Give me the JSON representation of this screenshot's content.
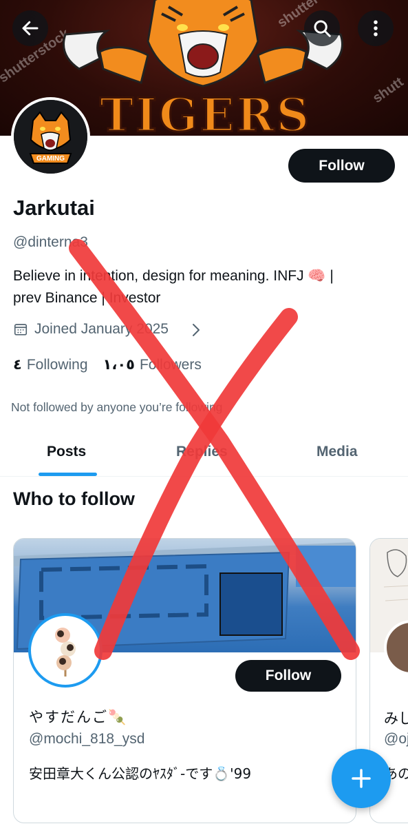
{
  "banner": {
    "text": "TIGERS",
    "watermarks": [
      "shutterstock",
      "shutterstock",
      "shutt"
    ]
  },
  "header": {
    "back_icon": "arrow-left-icon",
    "search_icon": "search-icon",
    "more_icon": "more-vertical-icon"
  },
  "profile": {
    "avatar_badge": "GAMING",
    "follow_label": "Follow",
    "name": "Jarkutai",
    "handle": "@dinterna3",
    "bio_line1": "Believe in intention, design for meaning. INFJ 🧠 |",
    "bio_line2": "prev Binance | Investor",
    "joined": "Joined January 2025",
    "following_count": "٤",
    "following_label": "Following",
    "followers_count": "١،٠٥",
    "followers_label": "Followers",
    "not_followed": "Not followed by anyone you’re following"
  },
  "tabs": [
    {
      "label": "Posts",
      "active": true
    },
    {
      "label": "Replies",
      "active": false
    },
    {
      "label": "Media",
      "active": false
    }
  ],
  "who_to_follow": {
    "title": "Who to follow",
    "cards": [
      {
        "name": "やすだんご🍡",
        "handle": "@mochi_818_ysd",
        "bio": "安田章大くん公認のﾔｽﾀﾞ-です💍'99",
        "follow_label": "Follow"
      },
      {
        "name": "みし",
        "handle": "@oj",
        "bio": "あの"
      }
    ]
  },
  "colors": {
    "accent": "#1d9bf0",
    "text_primary": "#0f1419",
    "text_secondary": "#536471",
    "overlay_x": "#f03a3a"
  },
  "fab_icon": "plus-icon"
}
